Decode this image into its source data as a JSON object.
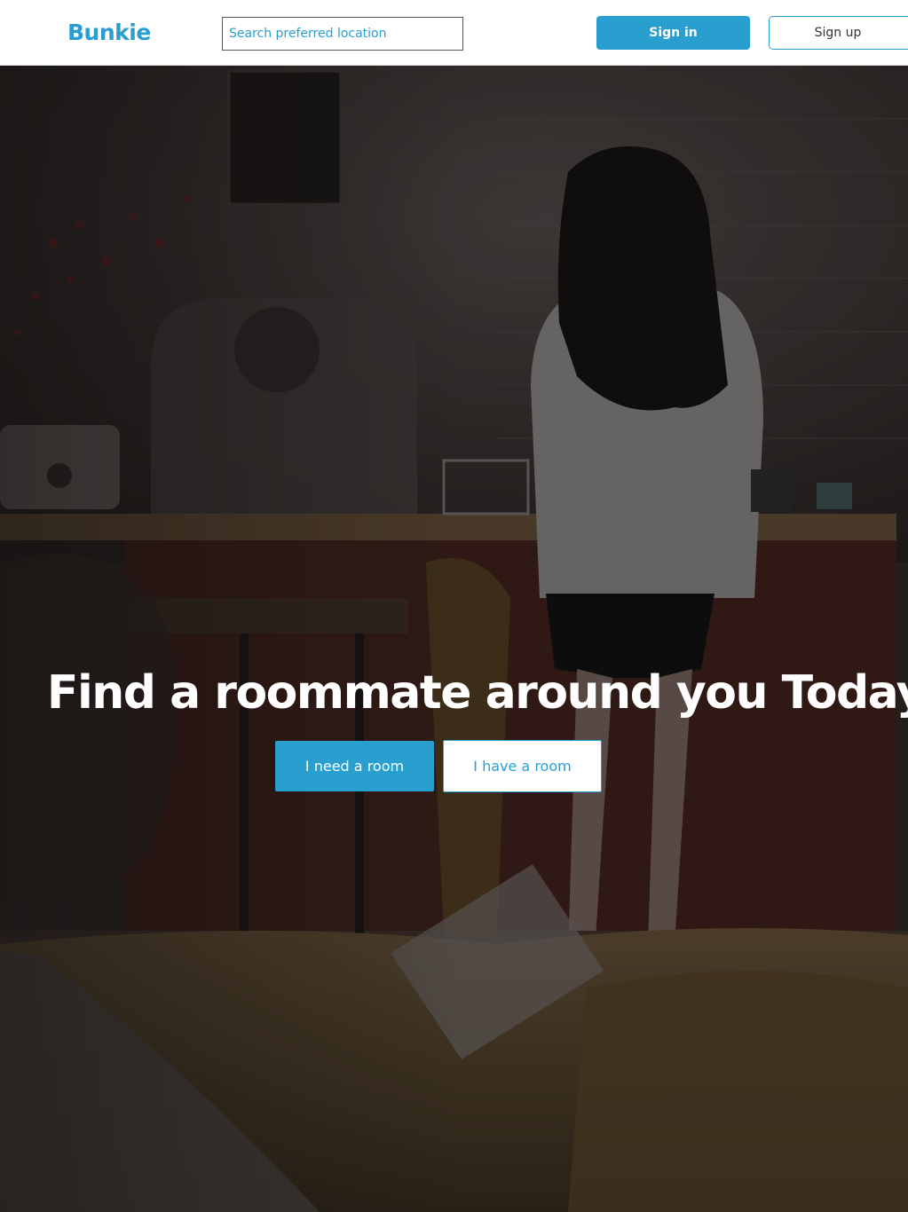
{
  "header": {
    "logo": "Bunkie",
    "search_placeholder": "Search preferred location",
    "signin_label": "Sign in",
    "signup_label": "Sign up"
  },
  "hero": {
    "title": "Find a roommate around you Today",
    "need_room_label": "I need a room",
    "have_room_label": "I have a room"
  },
  "colors": {
    "accent": "#299fcf",
    "header_bg": "#ffffff",
    "hero_text": "#ffffff"
  }
}
